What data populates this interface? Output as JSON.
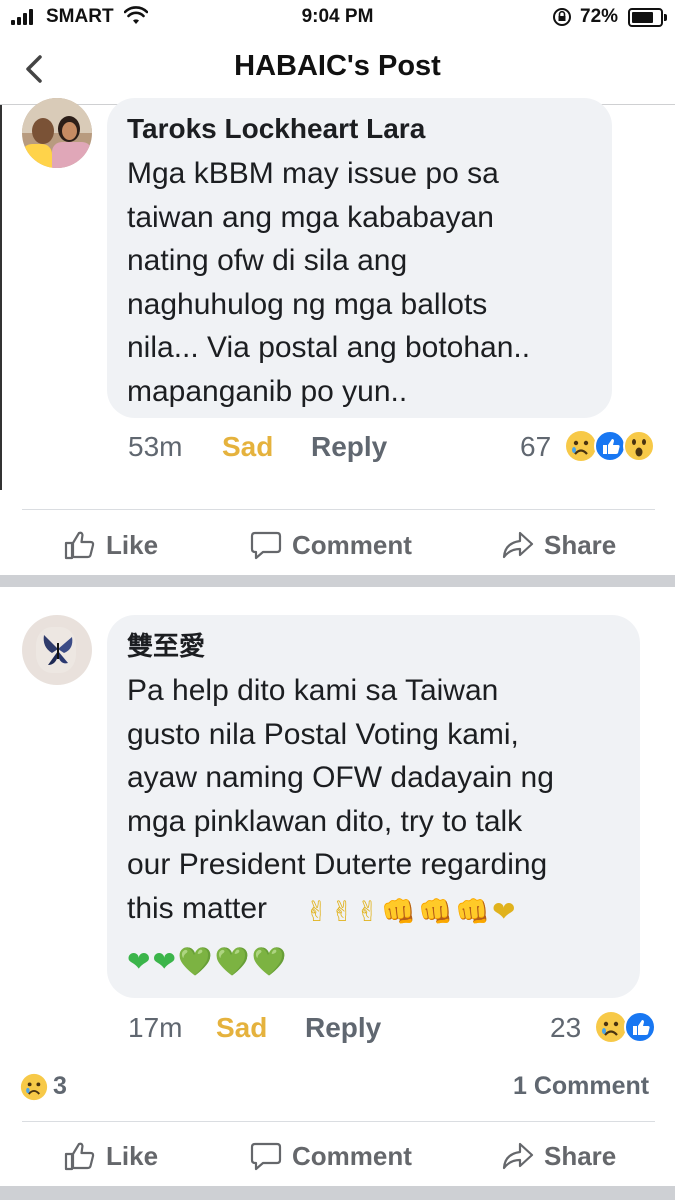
{
  "status": {
    "carrier": "SMART",
    "time": "9:04 PM",
    "battery": "72%"
  },
  "nav": {
    "title": "HABAIC's Post"
  },
  "comment1": {
    "author": "Taroks Lockheart Lara",
    "text": "Mga kBBM may issue po sa\ntaiwan ang mga kababayan\nnating ofw di sila ang\nnaghuhulog ng mga ballots\nnila... Via postal ang botohan..\nmapanganib po yun..",
    "time": "53m",
    "reaction": "Sad",
    "reply": "Reply",
    "count": "67",
    "reaction_icons": [
      "sad-icon",
      "like-icon",
      "wow-icon"
    ]
  },
  "actions1": {
    "like": "Like",
    "comment": "Comment",
    "share": "Share"
  },
  "comment2": {
    "author": "雙至愛",
    "text": "Pa help dito kami sa Taiwan\ngusto nila Postal Voting kami,\nayaw naming OFW dadayain ng\nmga pinklawan dito, try to talk\nour President Duterte regarding\nthis matter",
    "text_emojis_line1": "✌✌✌👊👊👊❤",
    "text_emojis_line2": "❤❤💚💚💚",
    "time": "17m",
    "reaction": "Sad",
    "reply": "Reply",
    "count": "23",
    "reaction_icons": [
      "sad-icon",
      "like-icon"
    ]
  },
  "post_footer": {
    "reaction_count": "3",
    "comments": "1 Comment"
  },
  "actions2": {
    "like": "Like",
    "comment": "Comment",
    "share": "Share"
  },
  "colors": {
    "sad": "#e5b23d",
    "like_blue": "#1877f2",
    "bubble": "#f0f2f5",
    "heart_red": "#e0242d",
    "heart_green": "#3bb54a"
  }
}
